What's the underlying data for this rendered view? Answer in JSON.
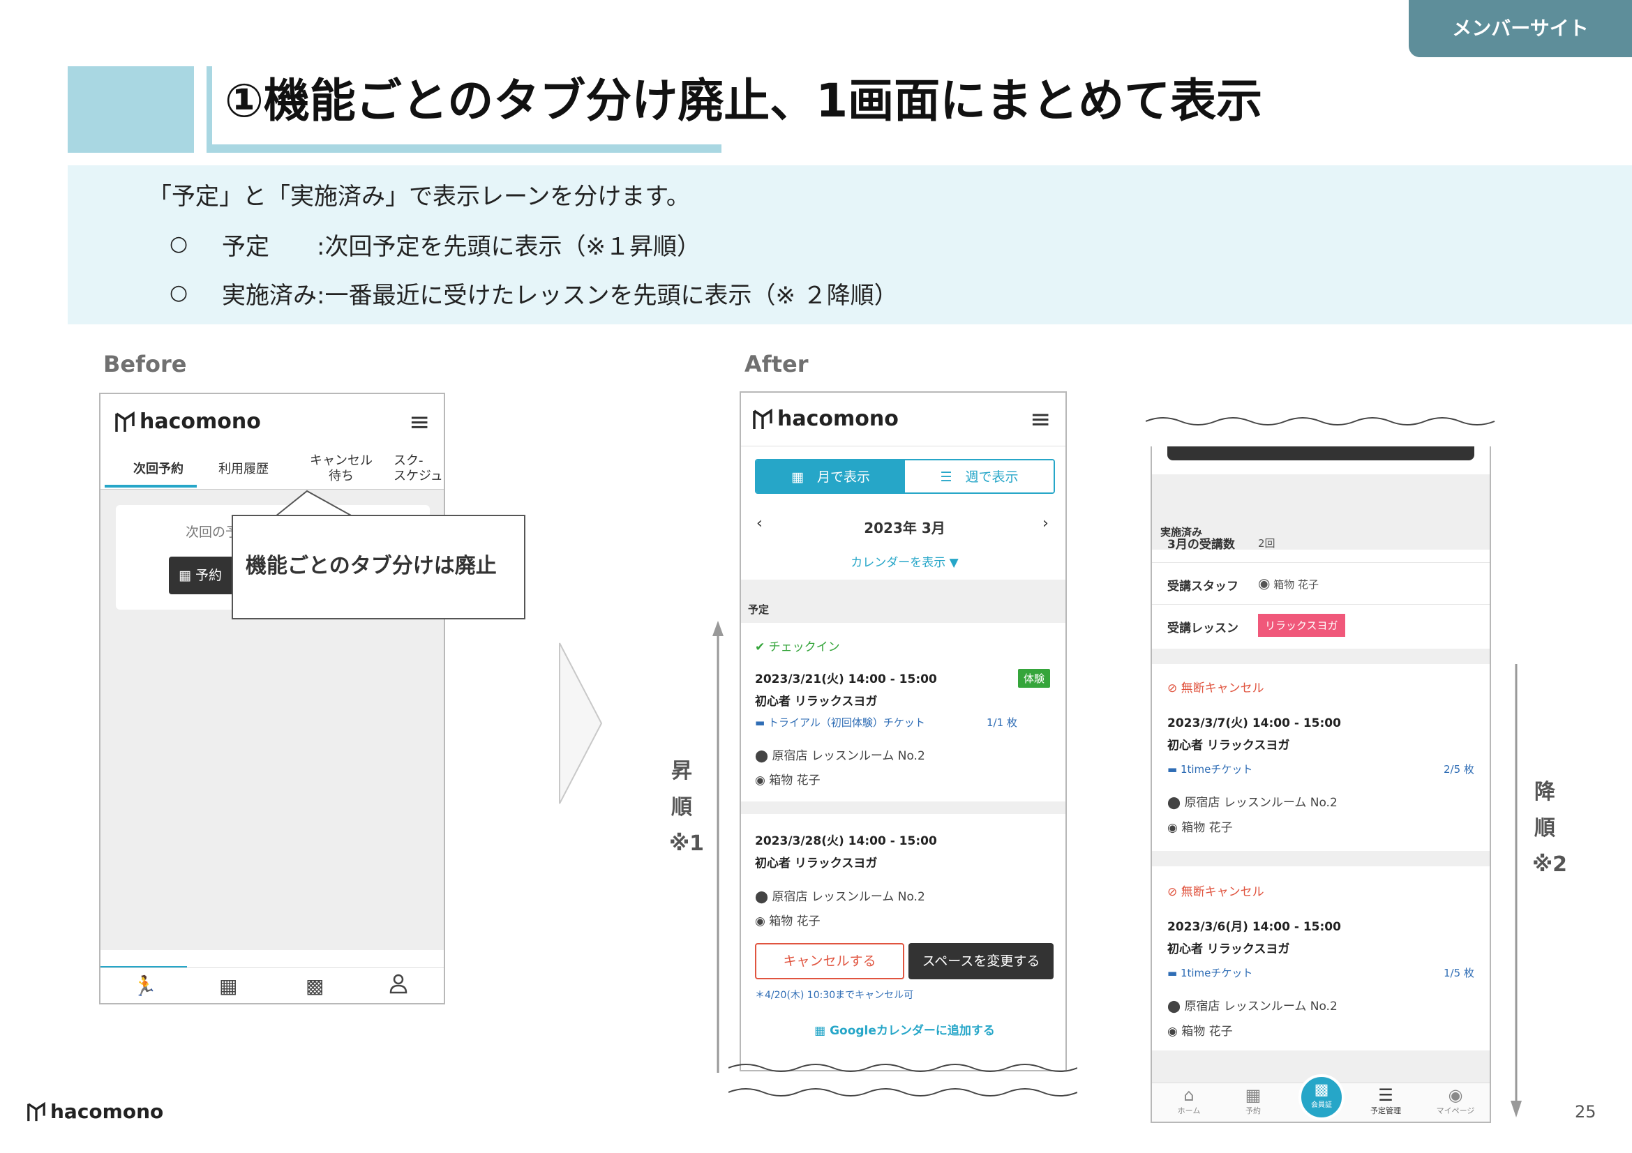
{
  "badge": "メンバーサイト",
  "title": "①機能ごとのタブ分け廃止、1画面にまとめて表示",
  "info": {
    "line1": "「予定」と「実施済み」で表示レーンを分けます。",
    "bullet": "○",
    "line2": "予定　　:次回予定を先頭に表示（※１昇順）",
    "line3": "実施済み:一番最近に受けたレッスンを先頭に表示（※ ２降順）"
  },
  "before": {
    "label": "Before",
    "logo": "hacomono",
    "tabs": [
      "次回予約",
      "利用履歴",
      "キャンセル\n待ち",
      "スク-\nスケジュ"
    ],
    "card_text": "次回の予",
    "card_button": "予約"
  },
  "callout": "機能ごとのタブ分けは廃止",
  "after": {
    "label": "After",
    "logo": "hacomono",
    "month_view": "月で表示",
    "week_view": "週で表示",
    "month": "2023年 3月",
    "show_calendar": "カレンダーを表示",
    "section_planned": "予定",
    "checkin": "チェックイン",
    "r1_date": "2023/3/21(火) 14:00 - 15:00",
    "r1_tag": "体験",
    "r1_lesson": "初心者 リラックスヨガ",
    "r1_ticket": "トライアル（初回体験）チケット",
    "r1_count": "1/1 枚",
    "location": "原宿店 レッスンルーム No.2",
    "staff": "箱物 花子",
    "r2_date": "2023/3/28(火) 14:00 - 15:00",
    "r2_lesson": "初心者 リラックスヨガ",
    "cancel_btn": "キャンセルする",
    "change_btn": "スペースを変更する",
    "cancel_note": "＊4/20(木) 10:30までキャンセル可",
    "gcal": "Googleカレンダーに追加する"
  },
  "asc": {
    "c1": "昇",
    "c2": "順",
    "c3": "※1"
  },
  "desc": {
    "c1": "降",
    "c2": "順",
    "c3": "※2"
  },
  "done": {
    "section": "実施済み",
    "count_label": "3月の受講数",
    "count_value": "2回",
    "staff_label": "受講スタッフ",
    "staff_value": "箱物 花子",
    "lesson_label": "受講レッスン",
    "lesson_value": "リラックスヨガ",
    "status": "無断キャンセル",
    "d1_date": "2023/3/7(火) 14:00 - 15:00",
    "d1_lesson": "初心者 リラックスヨガ",
    "ticket": "1timeチケット",
    "d1_count": "2/5 枚",
    "location": "原宿店 レッスンルーム No.2",
    "staff": "箱物 花子",
    "d2_date": "2023/3/6(月) 14:00 - 15:00",
    "d2_lesson": "初心者 リラックスヨガ",
    "d2_count": "1/5 枚",
    "nav": [
      "ホーム",
      "予約",
      "会員証",
      "予定管理",
      "マイページ"
    ]
  },
  "footer": {
    "logo": "hacomono",
    "page": "25"
  },
  "colors": {
    "teal": "#26a6c8",
    "accent_light": "#a9d7e2",
    "info_bg": "#e6f5f9",
    "badge": "#5e8e9a",
    "cancel_red": "#e0543f",
    "check_green": "#35a53b",
    "lesson_pink": "#f0587a"
  }
}
